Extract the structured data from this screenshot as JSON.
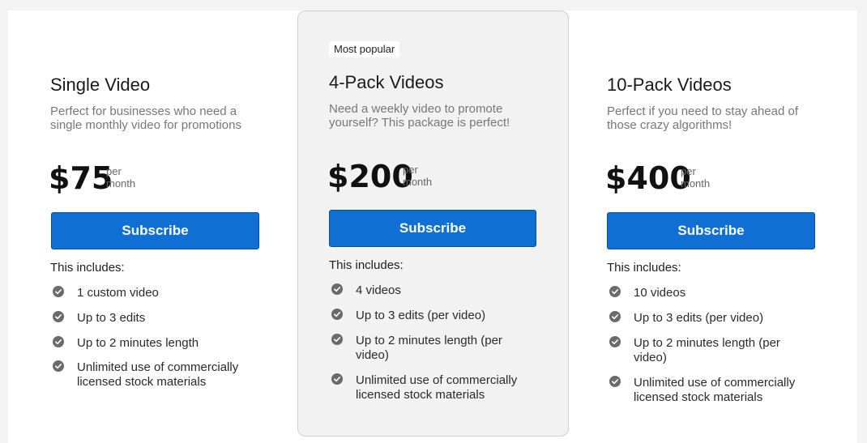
{
  "plans": [
    {
      "title": "Single Video",
      "description": "Perfect for businesses who need a single monthly video for promotions",
      "price": "$75",
      "period_line1": "per",
      "period_line2": "month",
      "button_label": "Subscribe",
      "includes_heading": "This includes:",
      "features": [
        "1 custom video",
        "Up to 3 edits",
        "Up to 2 minutes length",
        "Unlimited use of commercially licensed stock materials"
      ]
    },
    {
      "badge": "Most popular",
      "title": "4-Pack Videos",
      "description": "Need a weekly video to promote yourself? This package is perfect!",
      "price": "$200",
      "period_line1": "per",
      "period_line2": "month",
      "button_label": "Subscribe",
      "includes_heading": "This includes:",
      "features": [
        "4 videos",
        "Up to 3 edits (per video)",
        "Up to 2 minutes length (per video)",
        "Unlimited use of commercially licensed stock materials"
      ]
    },
    {
      "title": "10-Pack Videos",
      "description": "Perfect if you need to stay ahead of those crazy algorithms!",
      "price": "$400",
      "period_line1": "per",
      "period_line2": "month",
      "button_label": "Subscribe",
      "includes_heading": "This includes:",
      "features": [
        "10 videos",
        "Up to 3 edits (per video)",
        "Up to 2 minutes length (per video)",
        "Unlimited use of commercially licensed stock materials"
      ]
    }
  ],
  "colors": {
    "button": "#0f6fd3",
    "featured_card": "#f2f2f2",
    "check_icon": "#6b6b6b"
  },
  "icons": {
    "feature_check": "check-circle-icon"
  }
}
